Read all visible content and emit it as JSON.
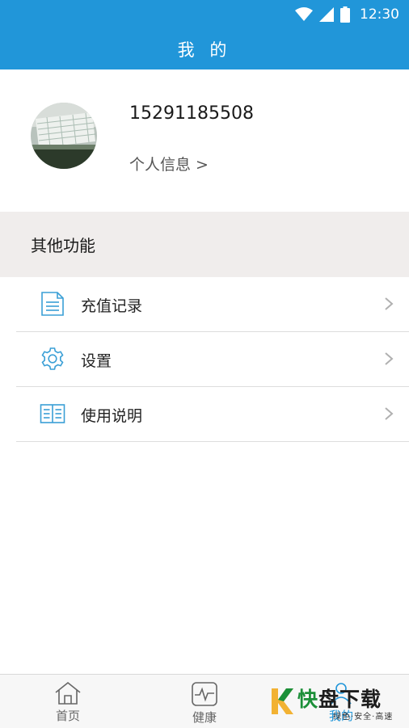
{
  "status_bar": {
    "time": "12:30",
    "icons": [
      "wifi-icon",
      "cell-signal-icon",
      "battery-icon"
    ]
  },
  "header": {
    "title": "我 的"
  },
  "profile": {
    "phone": "15291185508",
    "info_link": "个人信息 >"
  },
  "section": {
    "title": "其他功能"
  },
  "menu": {
    "items": [
      {
        "label": "充值记录",
        "icon": "document-icon"
      },
      {
        "label": "设置",
        "icon": "gear-icon"
      },
      {
        "label": "使用说明",
        "icon": "book-icon"
      }
    ]
  },
  "bottom_nav": {
    "items": [
      {
        "label": "首页",
        "icon": "home-icon"
      },
      {
        "label": "健康",
        "icon": "pulse-icon"
      },
      {
        "label": "我的",
        "icon": "person-icon",
        "active": true
      }
    ]
  },
  "watermark": {
    "main_kuai": "快",
    "main_rest": "盘下载",
    "sub": "绿色·安全·高速"
  },
  "colors": {
    "primary": "#2196d9",
    "section_bg": "#f0edec",
    "divider": "#dddddd",
    "watermark_green": "#1b8f38"
  }
}
